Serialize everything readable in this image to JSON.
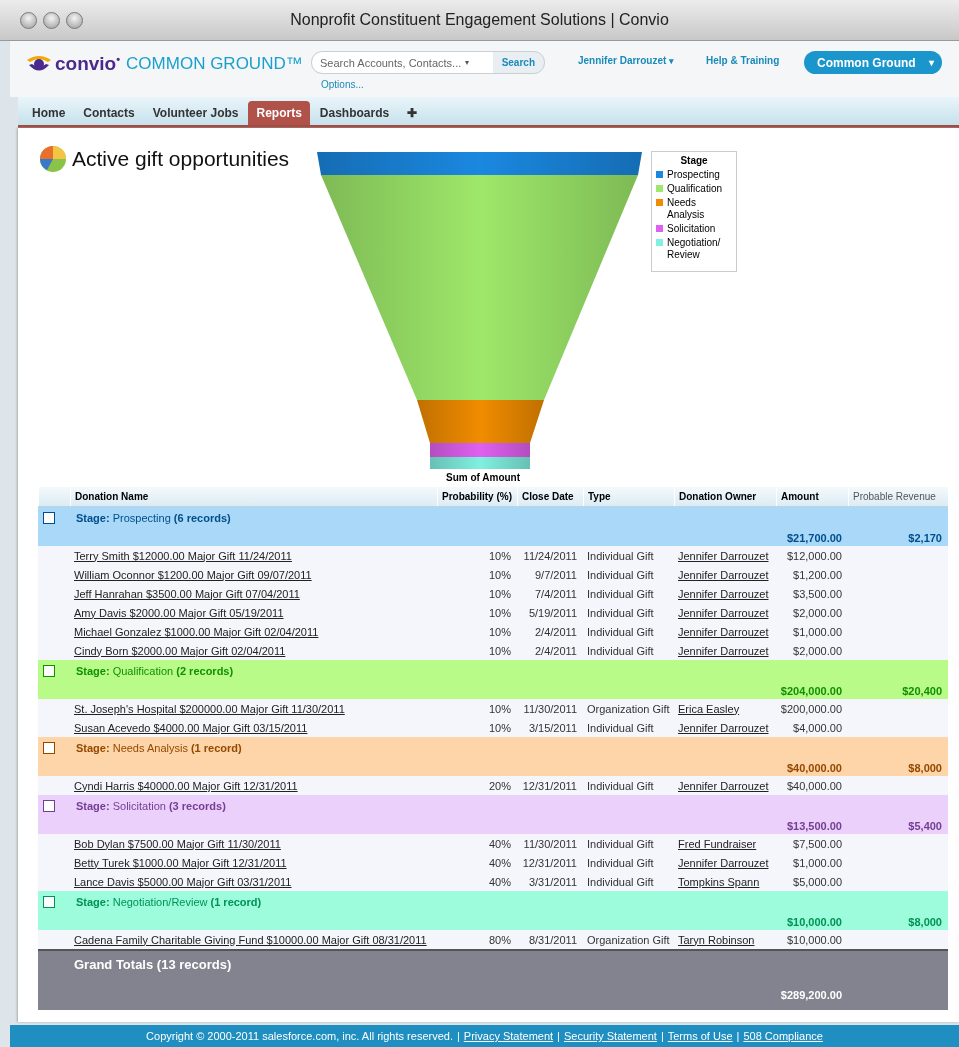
{
  "window": {
    "title": "Nonprofit Constituent Engagement Solutions | Convio"
  },
  "header": {
    "brand": "convio",
    "brand_dot": "•",
    "product": "COMMON GROUND™",
    "search": {
      "placeholder": "Search Accounts, Contacts...",
      "caret": "▾",
      "button": "Search",
      "options": "Options..."
    },
    "user": {
      "name": "Jennifer Darrouzet",
      "caret": "▾"
    },
    "help": "Help & Training",
    "app": {
      "label": "Common Ground",
      "caret": "▾"
    }
  },
  "tabs": [
    {
      "label": "Home",
      "selected": false
    },
    {
      "label": "Contacts",
      "selected": false
    },
    {
      "label": "Volunteer Jobs",
      "selected": false
    },
    {
      "label": "Reports",
      "selected": true
    },
    {
      "label": "Dashboards",
      "selected": false
    },
    {
      "label": "✚",
      "selected": false
    }
  ],
  "report": {
    "title": "Active gift opportunities",
    "funnel": {
      "caption": "Sum of Amount",
      "legend_title": "Stage",
      "legend": [
        {
          "label": "Prospecting",
          "color": "#1a88e0"
        },
        {
          "label": "Qualification",
          "color": "#9ee86a"
        },
        {
          "label": "Needs Analysis",
          "color": "#f08c00"
        },
        {
          "label": "Solicitation",
          "color": "#e060f0"
        },
        {
          "label": "Negotiation/ Review",
          "color": "#80f0e0"
        }
      ]
    }
  },
  "table": {
    "columns": [
      "Donation Name",
      "Probability (%)",
      "Close Date",
      "Type",
      "Donation Owner",
      "Amount",
      "Probable Revenue"
    ],
    "groups": [
      {
        "title": "**Stage:** Prospecting **(6 records)**",
        "color": "#a9d8f8",
        "checked": false,
        "amount": "$21,700.00",
        "revenue": "$2,170",
        "rows": [
          {
            "name": "Terry Smith $12000.00 Major Gift 11/24/2011",
            "probability": "10%",
            "close": "11/24/2011",
            "type": "Individual Gift",
            "owner": "Jennifer Darrouzet",
            "amount": "$12,000.00"
          },
          {
            "name": "William Oconnor $1200.00 Major Gift 09/07/2011",
            "probability": "10%",
            "close": "9/7/2011",
            "type": "Individual Gift",
            "owner": "Jennifer Darrouzet",
            "amount": "$1,200.00"
          },
          {
            "name": "Jeff Hanrahan $3500.00 Major Gift 07/04/2011",
            "probability": "10%",
            "close": "7/4/2011",
            "type": "Individual Gift",
            "owner": "Jennifer Darrouzet",
            "amount": "$3,500.00"
          },
          {
            "name": "Amy Davis $2000.00 Major Gift 05/19/2011",
            "probability": "10%",
            "close": "5/19/2011",
            "type": "Individual Gift",
            "owner": "Jennifer Darrouzet",
            "amount": "$2,000.00"
          },
          {
            "name": "Michael Gonzalez $1000.00 Major Gift 02/04/2011",
            "probability": "10%",
            "close": "2/4/2011",
            "type": "Individual Gift",
            "owner": "Jennifer Darrouzet",
            "amount": "$1,000.00"
          },
          {
            "name": "Cindy Born $2000.00 Major Gift 02/04/2011",
            "probability": "10%",
            "close": "2/4/2011",
            "type": "Individual Gift",
            "owner": "Jennifer Darrouzet",
            "amount": "$2,000.00"
          }
        ]
      },
      {
        "title": "**Stage:** Qualification **(2 records)**",
        "color": "#b8fb88",
        "checked": false,
        "amount": "$204,000.00",
        "revenue": "$20,400",
        "rows": [
          {
            "name": "St. Joseph's Hospital $200000.00 Major Gift 11/30/2011",
            "probability": "10%",
            "close": "11/30/2011",
            "type": "Organization Gift",
            "owner": "Erica Easley",
            "amount": "$200,000.00"
          },
          {
            "name": "Susan Acevedo $4000.00 Major Gift 03/15/2011",
            "probability": "10%",
            "close": "3/15/2011",
            "type": "Individual Gift",
            "owner": "Jennifer Darrouzet",
            "amount": "$4,000.00"
          }
        ]
      },
      {
        "title": "**Stage:** Needs Analysis **(1 record)**",
        "color": "#fdd5a8",
        "checked": false,
        "amount": "$40,000.00",
        "revenue": "$8,000",
        "rows": [
          {
            "name": "Cyndi Harris $40000.00 Major Gift 12/31/2011",
            "probability": "20%",
            "close": "12/31/2011",
            "type": "Individual Gift",
            "owner": "Jennifer Darrouzet",
            "amount": "$40,000.00"
          }
        ]
      },
      {
        "title": "**Stage:** Solicitation **(3 records)**",
        "color": "#ecd0fc",
        "checked": false,
        "amount": "$13,500.00",
        "revenue": "$5,400",
        "rows": [
          {
            "name": "Bob Dylan $7500.00 Major Gift 11/30/2011",
            "probability": "40%",
            "close": "11/30/2011",
            "type": "Individual Gift",
            "owner": "Fred Fundraiser",
            "amount": "$7,500.00"
          },
          {
            "name": "Betty Turek $1000.00 Major Gift 12/31/2011",
            "probability": "40%",
            "close": "12/31/2011",
            "type": "Individual Gift",
            "owner": "Jennifer Darrouzet",
            "amount": "$1,000.00"
          },
          {
            "name": "Lance Davis $5000.00 Major Gift 03/31/2011",
            "probability": "40%",
            "close": "3/31/2011",
            "type": "Individual Gift",
            "owner": "Tompkins Spann",
            "amount": "$5,000.00"
          }
        ]
      },
      {
        "title": "**Stage:** Negotiation/Review **(1 record)**",
        "color": "#9cfcdc",
        "checked": false,
        "amount": "$10,000.00",
        "revenue": "$8,000",
        "rows": [
          {
            "name": "Cadena Family Charitable Giving Fund $10000.00 Major Gift 08/31/2011",
            "probability": "80%",
            "close": "8/31/2011",
            "type": "Organization Gift",
            "owner": "Taryn Robinson",
            "amount": "$10,000.00"
          }
        ]
      }
    ],
    "grand_total": {
      "label": "Grand Totals (13 records)",
      "amount": "$289,200.00"
    }
  },
  "footer": {
    "copyright": "Copyright © 2000-2011 salesforce.com, inc. All rights reserved.",
    "separator": "|",
    "links": [
      "Privacy Statement",
      "Security Statement",
      "Terms of Use",
      "508 Compliance"
    ]
  }
}
